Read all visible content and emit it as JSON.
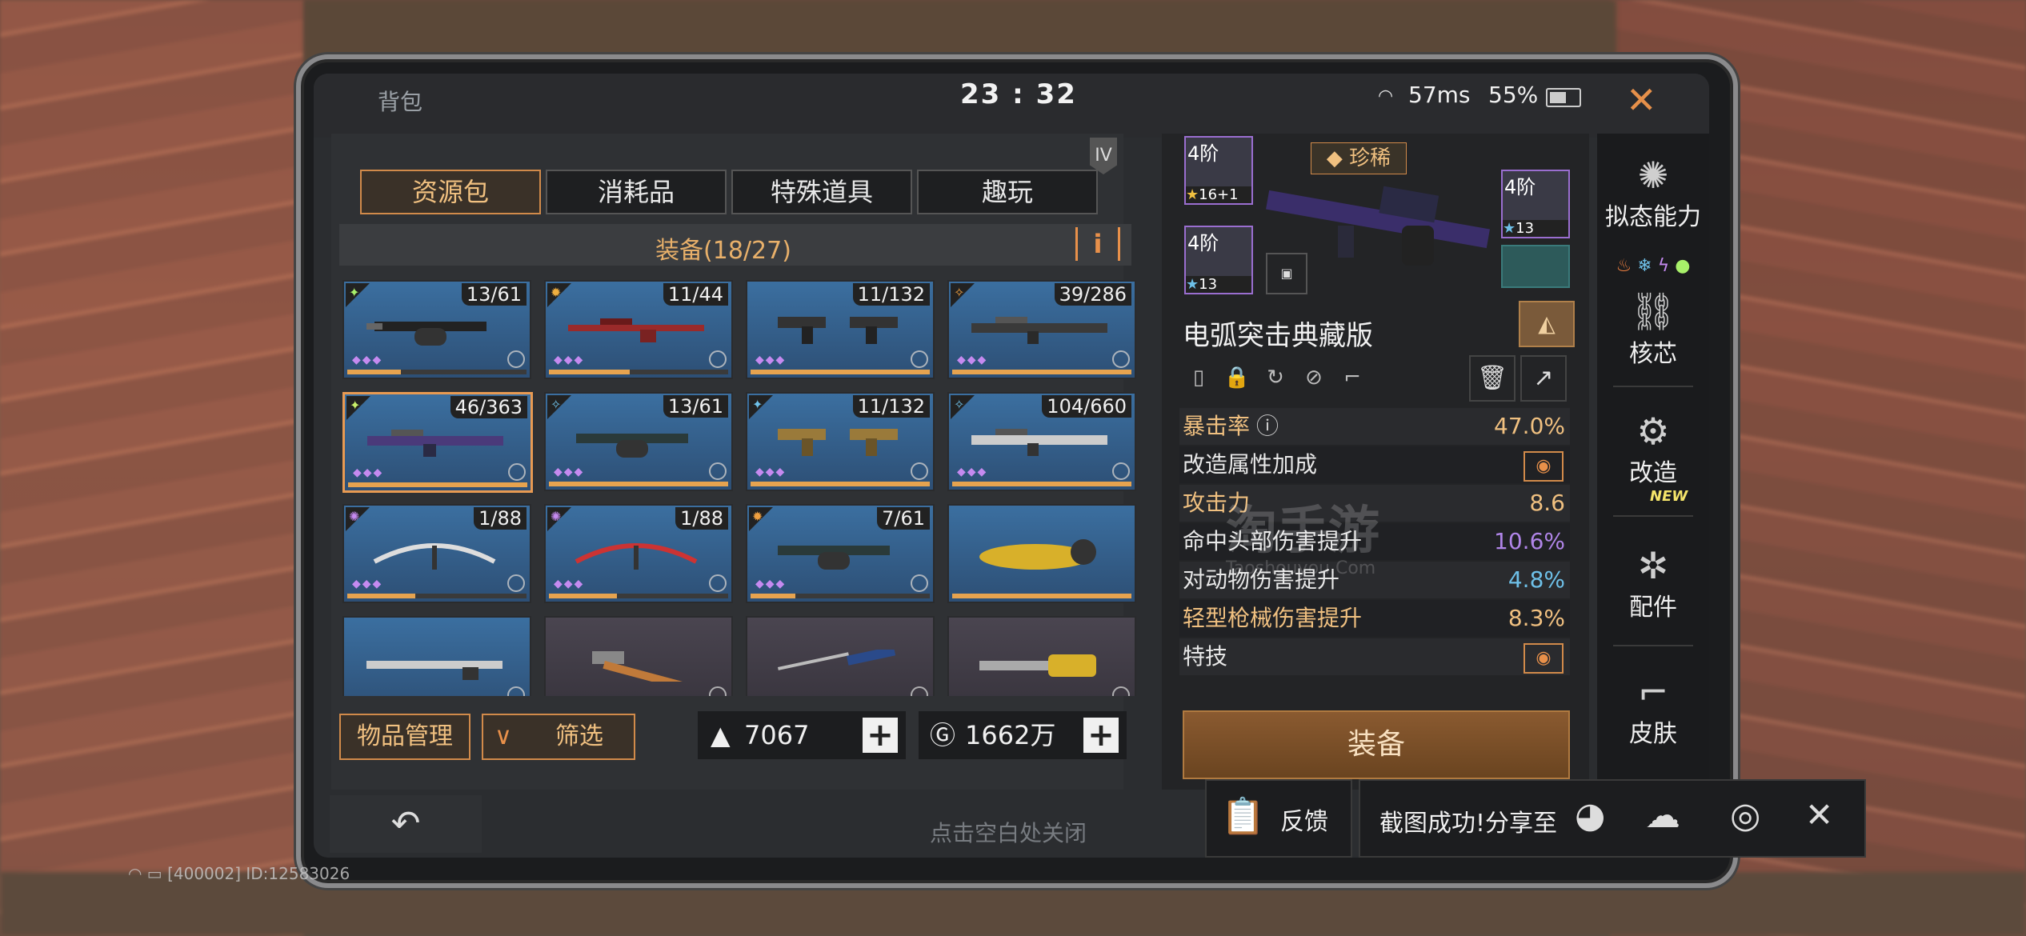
{
  "status": {
    "bag_title": "背包",
    "clock": "23 : 32",
    "ping": "57ms",
    "battery": "55%"
  },
  "tabs": [
    {
      "label": "资源包"
    },
    {
      "label": "消耗品"
    },
    {
      "label": "特殊道具"
    },
    {
      "label": "趣玩"
    }
  ],
  "tier_badge": "IV",
  "category": {
    "title": "装备(18/27)",
    "info": "i"
  },
  "items": [
    {
      "count": "13/61"
    },
    {
      "count": "11/44"
    },
    {
      "count": "11/132"
    },
    {
      "count": "39/286"
    },
    {
      "count": "46/363"
    },
    {
      "count": "13/61"
    },
    {
      "count": "11/132"
    },
    {
      "count": "104/660"
    },
    {
      "count": "1/88"
    },
    {
      "count": "1/88"
    },
    {
      "count": "7/61"
    },
    {
      "count": ""
    },
    {
      "count": ""
    },
    {
      "count": ""
    },
    {
      "count": ""
    },
    {
      "count": ""
    }
  ],
  "bottom": {
    "manage": "物品管理",
    "filter": "筛选",
    "currency1": "7067",
    "currency2": "1662万"
  },
  "hint": "点击空白处关闭",
  "detail": {
    "rarity": "珍稀",
    "name": "电弧突击典藏版",
    "slots": [
      {
        "tier": "4阶",
        "stars": "16+1"
      },
      {
        "tier": "4阶",
        "stars": "13"
      },
      {
        "tier": "4阶",
        "stars": "13"
      }
    ],
    "stats": [
      {
        "label": "暴击率",
        "value": "47.0%"
      },
      {
        "label": "改造属性加成",
        "value": ""
      },
      {
        "label": "攻击力",
        "value": "8.6"
      },
      {
        "label": "命中头部伤害提升",
        "value": "10.6%"
      },
      {
        "label": "对动物伤害提升",
        "value": "4.8%"
      },
      {
        "label": "轻型枪械伤害提升",
        "value": "8.3%"
      },
      {
        "label": "特技",
        "value": ""
      }
    ],
    "equip": "装备"
  },
  "sidenav": [
    {
      "label": "拟态能力"
    },
    {
      "label": "核芯"
    },
    {
      "label": "改造"
    },
    {
      "label": "配件"
    },
    {
      "label": "皮肤"
    }
  ],
  "new_tag": "NEW",
  "feedback": "反馈",
  "screenshot_share": "截图成功!分享至",
  "watermark": {
    "main": "淘手游",
    "sub": "Taoshouyou.Com"
  },
  "footer": "[400002] ID:12583026",
  "colors": {
    "accent": "#d18a4a",
    "gold": "#f0c080",
    "purple": "#b085e8",
    "cyan": "#6ec0e8"
  }
}
